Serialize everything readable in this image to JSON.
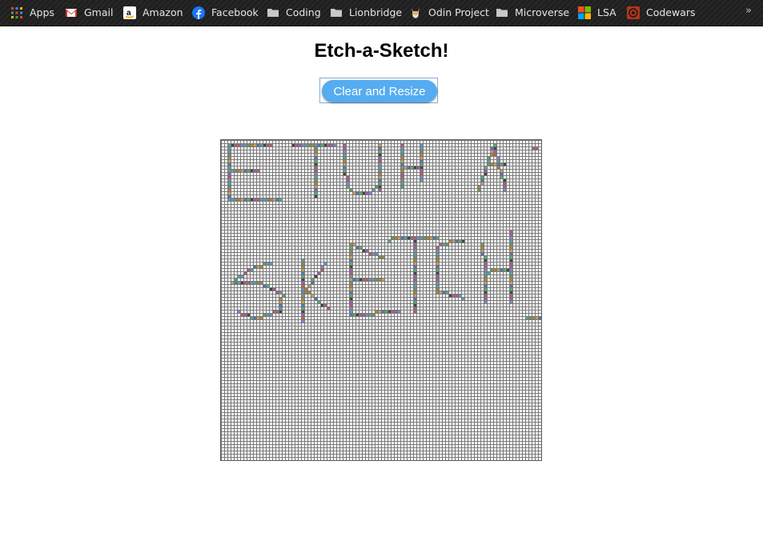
{
  "bookmarks": [
    {
      "label": "Apps",
      "icon": "apps-grid-icon"
    },
    {
      "label": "Gmail",
      "icon": "gmail-icon"
    },
    {
      "label": "Amazon",
      "icon": "amazon-icon"
    },
    {
      "label": "Facebook",
      "icon": "facebook-icon"
    },
    {
      "label": "Coding",
      "icon": "folder-icon"
    },
    {
      "label": "Lionbridge",
      "icon": "folder-icon"
    },
    {
      "label": "Odin Project",
      "icon": "odin-project-icon"
    },
    {
      "label": "Microverse",
      "icon": "folder-icon"
    },
    {
      "label": "LSA",
      "icon": "microsoft-icon"
    },
    {
      "label": "Codewars",
      "icon": "codewars-icon"
    }
  ],
  "overflow": "»",
  "page": {
    "title": "Etch-a-Sketch!",
    "clear_button_label": "Clear and Resize"
  },
  "grid": {
    "size": 100,
    "colors": [
      "#b85c5c",
      "#5c9c5c",
      "#5c6cc8",
      "#a05ca0",
      "#5ca0a0",
      "#b8a84c",
      "#444444",
      "#6c8cd8",
      "#c07840",
      "#4cb06c"
    ]
  }
}
